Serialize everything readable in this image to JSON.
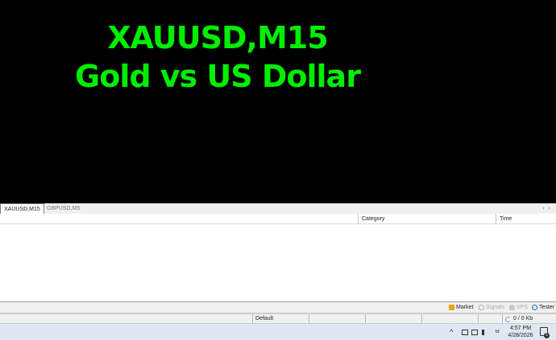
{
  "chart": {
    "symbol_timeframe": "XAUUSD,M15",
    "description": "Gold vs US Dollar",
    "background_color": "#000000",
    "text_color": "#00ee00"
  },
  "chart_tabs": [
    {
      "label": "XAUUSD,M15",
      "active": true
    },
    {
      "label": "GBPUSD,M5",
      "active": false
    }
  ],
  "tab_scroll": {
    "left_icon": "chevron-left-icon",
    "right_icon": "chevron-right-icon",
    "left_glyph": "‹",
    "right_glyph": "›"
  },
  "toolbox": {
    "columns": [
      "",
      "Category",
      "Time"
    ]
  },
  "toolbox_tabs": [
    {
      "label": "Market",
      "icon": "market-bag-icon",
      "enabled": true
    },
    {
      "label": "Signals",
      "icon": "signals-icon",
      "enabled": false
    },
    {
      "label": "VPS",
      "icon": "vps-cloud-icon",
      "enabled": false
    },
    {
      "label": "Tester",
      "icon": "tester-icon",
      "enabled": true
    }
  ],
  "status_bar": {
    "profile": "Default",
    "connection": "0 / 0 Kb"
  },
  "taskbar": {
    "tray_chevron": "^",
    "ime": "ㅂ",
    "time": "4:57 PM",
    "date": "4/28/2026",
    "notification_count": "1"
  }
}
